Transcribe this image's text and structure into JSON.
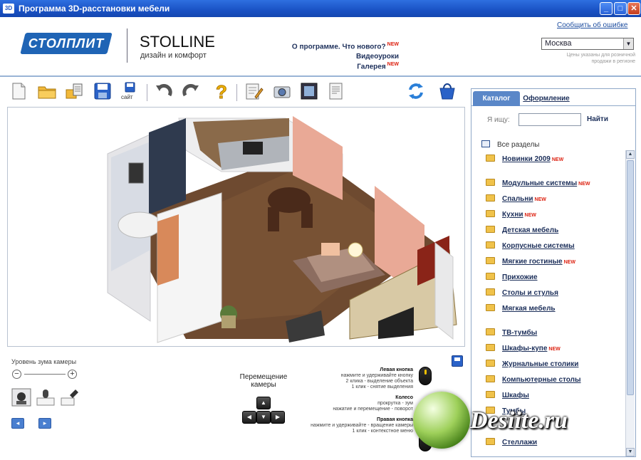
{
  "window": {
    "icon_text": "3D",
    "title": "Программа 3D-расстановки мебели",
    "buttons": {
      "minimize": "_",
      "maximize": "□",
      "close": "✕"
    }
  },
  "header": {
    "brand_left": "СТОЛПЛИТ",
    "brand_right": "STOLLINE",
    "brand_right_sub": "дизайн и комфорт",
    "links": [
      {
        "label": "О программе. Что нового?",
        "badge": "NEW"
      },
      {
        "label": "Видеоуроки",
        "badge": ""
      },
      {
        "label": "Галерея",
        "badge": "NEW"
      }
    ],
    "report_link": "Сообщить об ошибке",
    "city": "Москва",
    "note": "Цены указаны для розничной продажи в регионе"
  },
  "toolbar": {
    "save_caption": "сайт",
    "icons": [
      "new-document-icon",
      "open-folder-icon",
      "import-icon",
      "save-icon",
      "save-site-icon",
      "undo-icon",
      "redo-icon",
      "help-icon",
      "edit-plan-icon",
      "camera-icon",
      "frame-icon",
      "print-icon",
      "refresh-icon",
      "cart-icon"
    ]
  },
  "right_panel": {
    "tabs": [
      {
        "label": "Каталог"
      },
      {
        "label": "Оформление"
      }
    ],
    "search_label": "Я ищу:",
    "search_value": "",
    "search_button": "Найти",
    "all_sections": "Все разделы",
    "categories": [
      {
        "label": "Новинки 2009",
        "badge": "NEW"
      },
      {
        "label": "Модульные системы",
        "badge": "NEW"
      },
      {
        "label": "Спальни",
        "badge": "NEW"
      },
      {
        "label": "Кухни",
        "badge": "NEW"
      },
      {
        "label": "Детская мебель",
        "badge": ""
      },
      {
        "label": "Корпусные системы",
        "badge": ""
      },
      {
        "label": "Мягкие гостиные",
        "badge": "NEW"
      },
      {
        "label": "Прихожие",
        "badge": ""
      },
      {
        "label": "Столы и стулья",
        "badge": ""
      },
      {
        "label": "Мягкая мебель",
        "badge": ""
      },
      {
        "label": "ТВ-тумбы",
        "badge": ""
      },
      {
        "label": "Шкафы-купе",
        "badge": "NEW"
      },
      {
        "label": "Журнальные столики",
        "badge": ""
      },
      {
        "label": "Компьютерные столы",
        "badge": ""
      },
      {
        "label": "Шкафы",
        "badge": ""
      },
      {
        "label": "Тумбы",
        "badge": ""
      },
      {
        "label": "Стеллажи",
        "badge": ""
      }
    ]
  },
  "bottom": {
    "zoom_label": "Уровень зума камеры",
    "camera_label": "Перемещение камеры",
    "mouse_help": [
      {
        "title": "Левая кнопка",
        "lines": [
          "нажмите и удерживайте кнопку",
          "2 клика - выделение объекта",
          "1 клик - снятие выделения"
        ]
      },
      {
        "title": "Колесо",
        "lines": [
          "прокрутка - зум",
          "нажатие и перемещение - поворот"
        ]
      },
      {
        "title": "Правая кнопка",
        "lines": [
          "нажмите и удерживайте - вращение камеры",
          "1 клик - контекстное меню"
        ]
      }
    ]
  },
  "watermark": {
    "text": "Desiite.ru"
  }
}
